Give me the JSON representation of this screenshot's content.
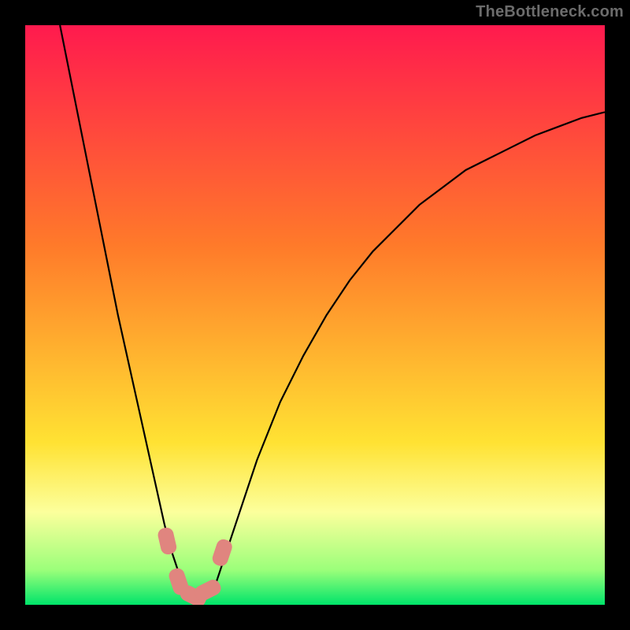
{
  "watermark": "TheBottleneck.com",
  "colors": {
    "frame": "#000000",
    "curve": "#000000",
    "marker_fill": "#e0857f",
    "marker_stroke": "#000000",
    "watermark": "#6c6c6c",
    "gradient_top": "#ff1a4e",
    "gradient_mid_upper": "#ff7a2a",
    "gradient_mid_lower": "#ffe233",
    "gradient_band": "#fcff9c",
    "gradient_bottom": "#00e46a"
  },
  "chart_data": {
    "type": "line",
    "title": "",
    "xlabel": "",
    "ylabel": "",
    "xlim": [
      0,
      100
    ],
    "ylim": [
      0,
      100
    ],
    "grid": false,
    "legend": false,
    "series": [
      {
        "name": "curve",
        "x": [
          6,
          8,
          10,
          12,
          14,
          16,
          18,
          20,
          22,
          24,
          25,
          26,
          27,
          28,
          29,
          30,
          31,
          32,
          33,
          34,
          36,
          38,
          40,
          44,
          48,
          52,
          56,
          60,
          64,
          68,
          72,
          76,
          80,
          84,
          88,
          92,
          96,
          100
        ],
        "y": [
          100,
          90,
          80,
          70,
          60,
          50,
          41,
          32,
          23,
          14,
          10,
          7,
          4,
          2,
          1,
          1,
          1,
          2,
          4,
          7,
          13,
          19,
          25,
          35,
          43,
          50,
          56,
          61,
          65,
          69,
          72,
          75,
          77,
          79,
          81,
          82.5,
          84,
          85
        ]
      }
    ],
    "markers": [
      {
        "x": 24.5,
        "y": 11
      },
      {
        "x": 26.5,
        "y": 4
      },
      {
        "x": 29,
        "y": 1.5
      },
      {
        "x": 31.5,
        "y": 2.5
      },
      {
        "x": 34,
        "y": 9
      }
    ]
  }
}
